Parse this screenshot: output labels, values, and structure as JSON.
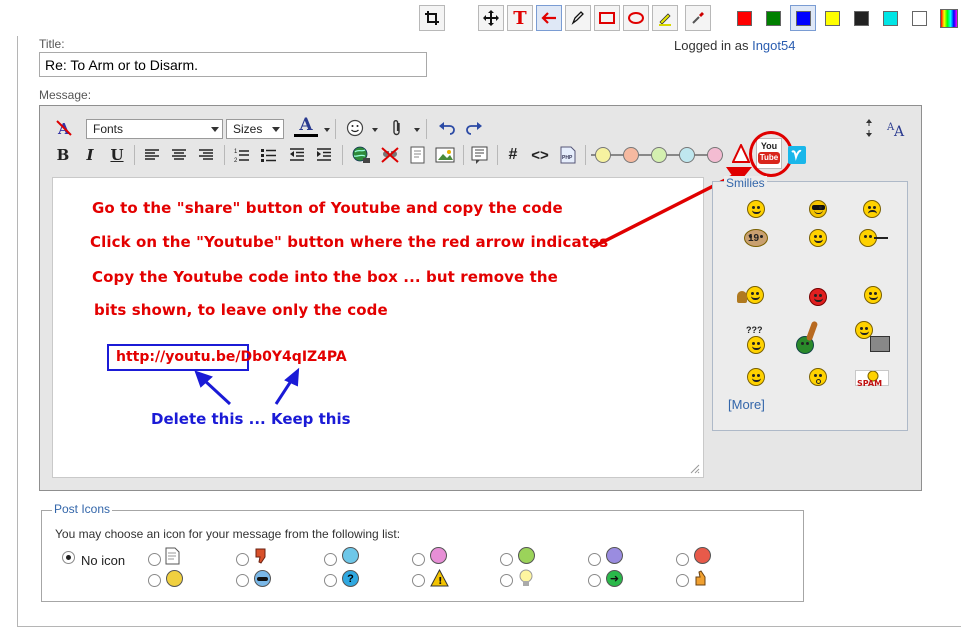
{
  "annotation_toolbar": {
    "tools": [
      {
        "name": "crop-icon"
      },
      {
        "name": "move-icon"
      },
      {
        "name": "text-tool-icon",
        "glyph": "T"
      },
      {
        "name": "arrow-tool-icon"
      },
      {
        "name": "pencil-icon"
      },
      {
        "name": "rectangle-icon"
      },
      {
        "name": "ellipse-icon"
      },
      {
        "name": "highlighter-icon"
      },
      {
        "name": "eyedropper-icon"
      }
    ],
    "colors": [
      "#ff0000",
      "#008000",
      "#0000ff",
      "#ffff00",
      "#222222",
      "#00e5e5",
      "#ffffff"
    ],
    "selected_color": "#0000ff"
  },
  "form": {
    "title_label": "Title:",
    "title_value": "Re: To Arm or to Disarm.",
    "logged_in_prefix": "Logged in as",
    "username": "Ingot54",
    "message_label": "Message:"
  },
  "editor": {
    "fonts_label": "Fonts",
    "sizes_label": "Sizes",
    "font_color_glyph": "A",
    "bold": "B",
    "italic": "I",
    "underline": "U",
    "code_hash": "#",
    "code_brackets": "<>",
    "circle_colors": [
      "#f6f2a0",
      "#f6b9a0",
      "#d4f0b0",
      "#bfe7ef",
      "#f3bcd2"
    ],
    "youtube_top": "You",
    "youtube_bottom": "Tube"
  },
  "instructions": [
    "Go to the \"share\" button of Youtube  and copy the code",
    "Click on the \"Youtube\" button where the red arrow indicates",
    "Copy the Youtube code into the box ... but remove the",
    "bits shown, to leave only the code"
  ],
  "url_example": {
    "prefix": "http://youtu.be/",
    "code": "Db0Y4qIZ4PA"
  },
  "keep_note": "Delete this ... Keep this",
  "smilies": {
    "title": "Smilies",
    "more_open": "[",
    "more_link": "More",
    "more_close": "]"
  },
  "post_icons": {
    "legend": "Post Icons",
    "description": "You may choose an icon for your message from the following list:",
    "no_icon_label": "No icon",
    "selected": "no-icon",
    "row1_icons": [
      "page-icon",
      "thumbs-down-icon",
      "wink-icon",
      "tongue-icon",
      "grin-icon",
      "sad-icon",
      "angry-icon"
    ],
    "row2_icons": [
      "smile-icon",
      "cool-icon",
      "question-icon",
      "warning-icon",
      "lightbulb-icon",
      "arrow-right-icon",
      "thumbs-up-icon"
    ],
    "question_glyph": "?",
    "warning_glyph": "!",
    "arrow_glyph": "➜"
  }
}
